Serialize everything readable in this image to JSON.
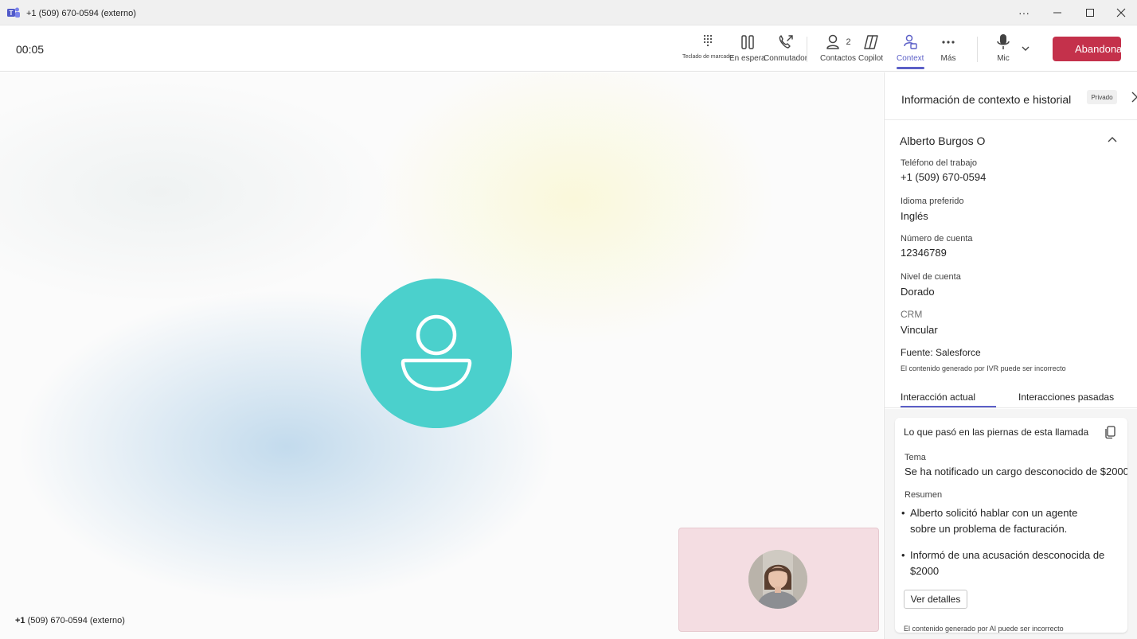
{
  "window": {
    "title": "+1 (509) 670-0594 (externo)",
    "app_icon": "teams-icon",
    "controls": [
      "more-icon",
      "minimize-icon",
      "maximize-icon",
      "close-icon"
    ]
  },
  "call": {
    "timer": "00:05",
    "toolbar": {
      "dialpad": "Teclado de marcado",
      "hold": "En espera",
      "transfer": "Conmutador",
      "contacts": "Contactos",
      "contacts_count": "2",
      "copilot": "Copilot",
      "context": "Context",
      "more": "Más",
      "mic": "Mic",
      "leave": "Abandonar"
    },
    "caller_label_bold": "+1",
    "caller_label_rest": " (509) 670-0594 (externo)",
    "colors": {
      "accent": "#5b5fc7",
      "leave": "#c4314b",
      "avatar": "#4bd0cc"
    }
  },
  "panel": {
    "title": "Información de contexto e historial",
    "private_badge": "Privado",
    "contact": {
      "name": "Alberto Burgos O",
      "fields": [
        {
          "label": "Teléfono del trabajo",
          "value": "+1 (509) 670-0594"
        },
        {
          "label": "Idioma preferido",
          "value": "Inglés"
        },
        {
          "label": "Número de cuenta",
          "value": "12346789"
        },
        {
          "label": "Nivel de cuenta",
          "value": "Dorado"
        },
        {
          "label": "CRM",
          "value": "Vincular"
        }
      ],
      "source": "Fuente: Salesforce",
      "ivr_note": "El contenido generado por IVR puede ser incorrecto"
    },
    "tabs": [
      "Interacción actual",
      "Interacciones pasadas"
    ],
    "summary": {
      "title": "Lo que pasó en las piernas de esta llamada",
      "topic_label": "Tema",
      "topic": "Se ha notificado un cargo desconocido de $2000",
      "summary_label": "Resumen",
      "bullets": [
        {
          "line1": "Alberto solicitó hablar con un agente",
          "line2": "sobre un problema de facturación."
        },
        {
          "line1": "Informó de una acusación desconocida de",
          "line2": "$2000"
        }
      ],
      "details_button": "Ver detalles",
      "ai_note": "El contenido generado por AI puede ser incorrecto"
    }
  }
}
